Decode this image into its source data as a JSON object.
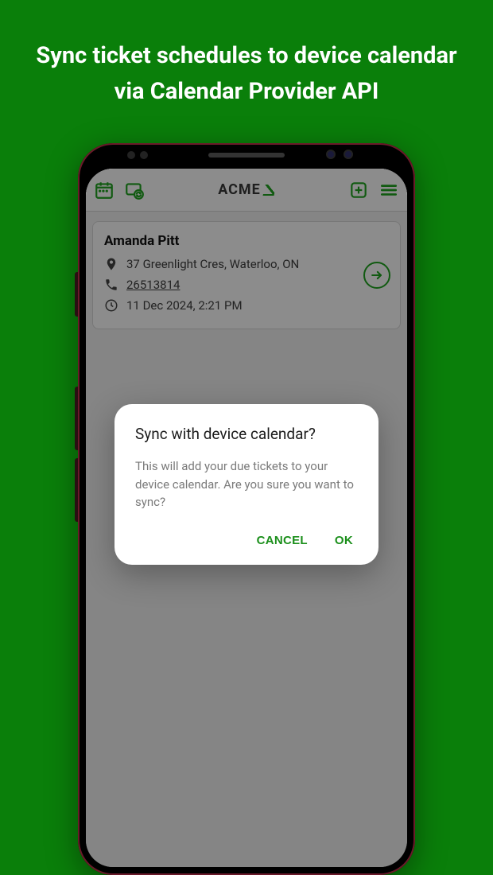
{
  "headline": "Sync ticket schedules to device calendar via Calendar Provider API",
  "app": {
    "brand": "ACME"
  },
  "ticket": {
    "name": "Amanda Pitt",
    "address": "37 Greenlight Cres, Waterloo, ON",
    "phone": "26513814",
    "datetime": "11 Dec 2024, 2:21 PM"
  },
  "dialog": {
    "title": "Sync with device calendar?",
    "body": "This will add your due tickets to your device calendar. Are you sure you want to sync?",
    "cancel": "CANCEL",
    "ok": "OK"
  }
}
